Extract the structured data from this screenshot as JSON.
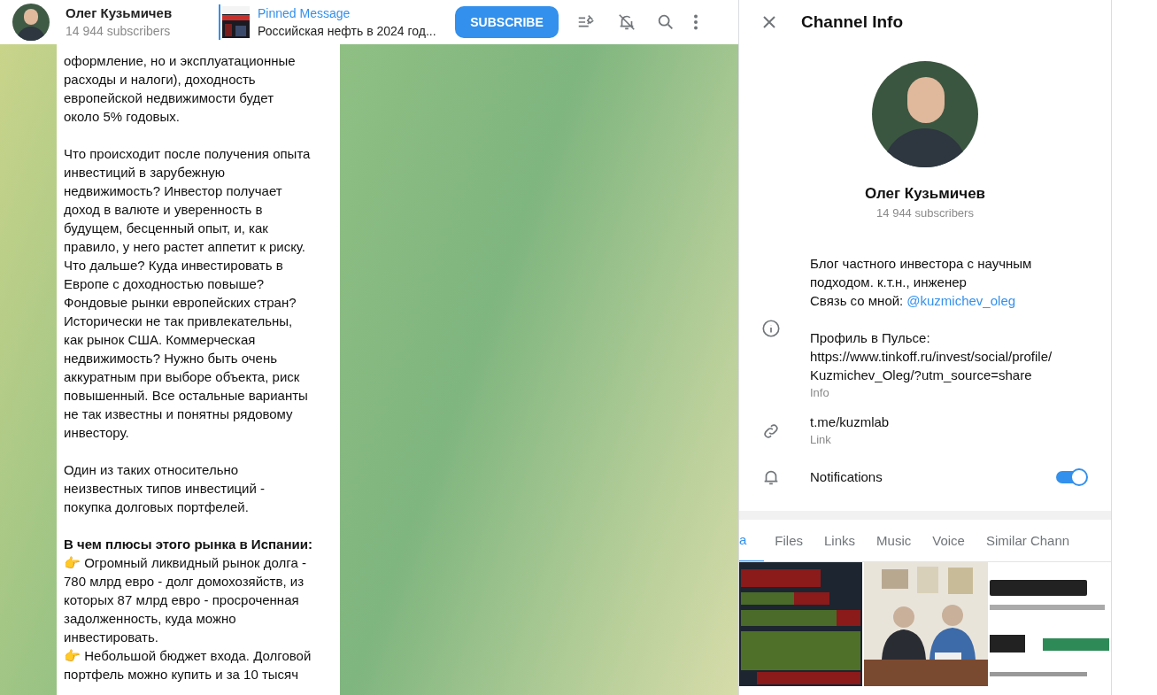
{
  "header": {
    "channel_name": "Олег Кузьмичев",
    "subscribers": "14 944 subscribers",
    "pinned": {
      "label": "Pinned Message",
      "text": "Российская нефть в 2024 год..."
    },
    "subscribe_button": "SUBSCRIBE"
  },
  "message": {
    "paragraphs": [
      [
        "оформление, но и эксплуатационные",
        "расходы и налоги), доходность",
        "европейской недвижимости будет",
        "около 5% годовых."
      ],
      [
        "Что происходит после получения опыта",
        "инвестиций в зарубежную",
        "недвижимость? Инвестор получает",
        "доход в валюте и уверенность в",
        "будущем, бесценный опыт, и, как",
        "правило, у него растет аппетит к риску.",
        "Что дальше? Куда инвестировать в",
        "Европе с доходностью повыше?",
        "Фондовые рынки европейских стран?",
        "Исторически не так привлекательны,",
        "как рынок США. Коммерческая",
        "недвижимость? Нужно быть очень",
        "аккуратным при выборе объекта, риск",
        "повышенный. Все остальные варианты",
        "не так известны и понятны рядовому",
        "инвестору."
      ],
      [
        "Один из таких относительно",
        "неизвестных типов инвестиций -",
        "покупка долговых портфелей."
      ],
      [
        "**В чем плюсы этого рынка в Испании:**",
        "👉 Огромный ликвидный рынок долга -",
        "780 млрд евро - долг домохозяйств, из",
        "которых 87 млрд евро - просроченная",
        "задолженность, куда можно",
        "инвестировать.",
        "👉 Небольшой бюджет входа. Долговой",
        "портфель можно купить и за 10 тысяч"
      ]
    ]
  },
  "info_panel": {
    "title": "Channel Info",
    "name": "Олег Кузьмичев",
    "subscribers": "14 944 subscribers",
    "rows": [
      {
        "kind": "info",
        "lines": [
          "Блог частного инвестора с научным",
          "подходом. к.т.н., инженер"
        ],
        "contact_label": "Связь со мной:",
        "contact_username": "@kuzmichev_oleg",
        "profile_lines": [
          "Профиль в Пульсе:",
          "https://www.tinkoff.ru/invest/social/profile/",
          "Kuzmichev_Oleg/?utm_source=share"
        ],
        "caption": "Info"
      },
      {
        "kind": "link",
        "lines": [
          "t.me/kuzmlab"
        ],
        "caption": "Link"
      },
      {
        "kind": "notifications",
        "lines": [
          "Notifications"
        ],
        "on": true
      }
    ],
    "tabs": [
      {
        "label": "a",
        "selected": true
      },
      {
        "label": "Files",
        "selected": false
      },
      {
        "label": "Links",
        "selected": false
      },
      {
        "label": "Music",
        "selected": false
      },
      {
        "label": "Voice",
        "selected": false
      },
      {
        "label": "Similar Chann",
        "selected": false
      }
    ]
  }
}
